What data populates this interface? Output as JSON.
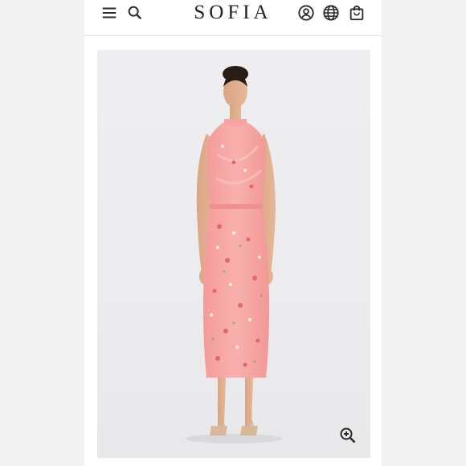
{
  "header": {
    "brand": "SOFIA",
    "icons": [
      "menu-icon",
      "search-icon",
      "account-icon",
      "globe-icon",
      "bag-icon"
    ]
  },
  "product": {
    "image_subject": "model-in-pink-floral-satin-dress",
    "zoom_icon": "zoom-in-icon"
  },
  "colors": {
    "icon": "#2a2a2a",
    "dress": "#f6a7a6",
    "background": "#ededef"
  }
}
